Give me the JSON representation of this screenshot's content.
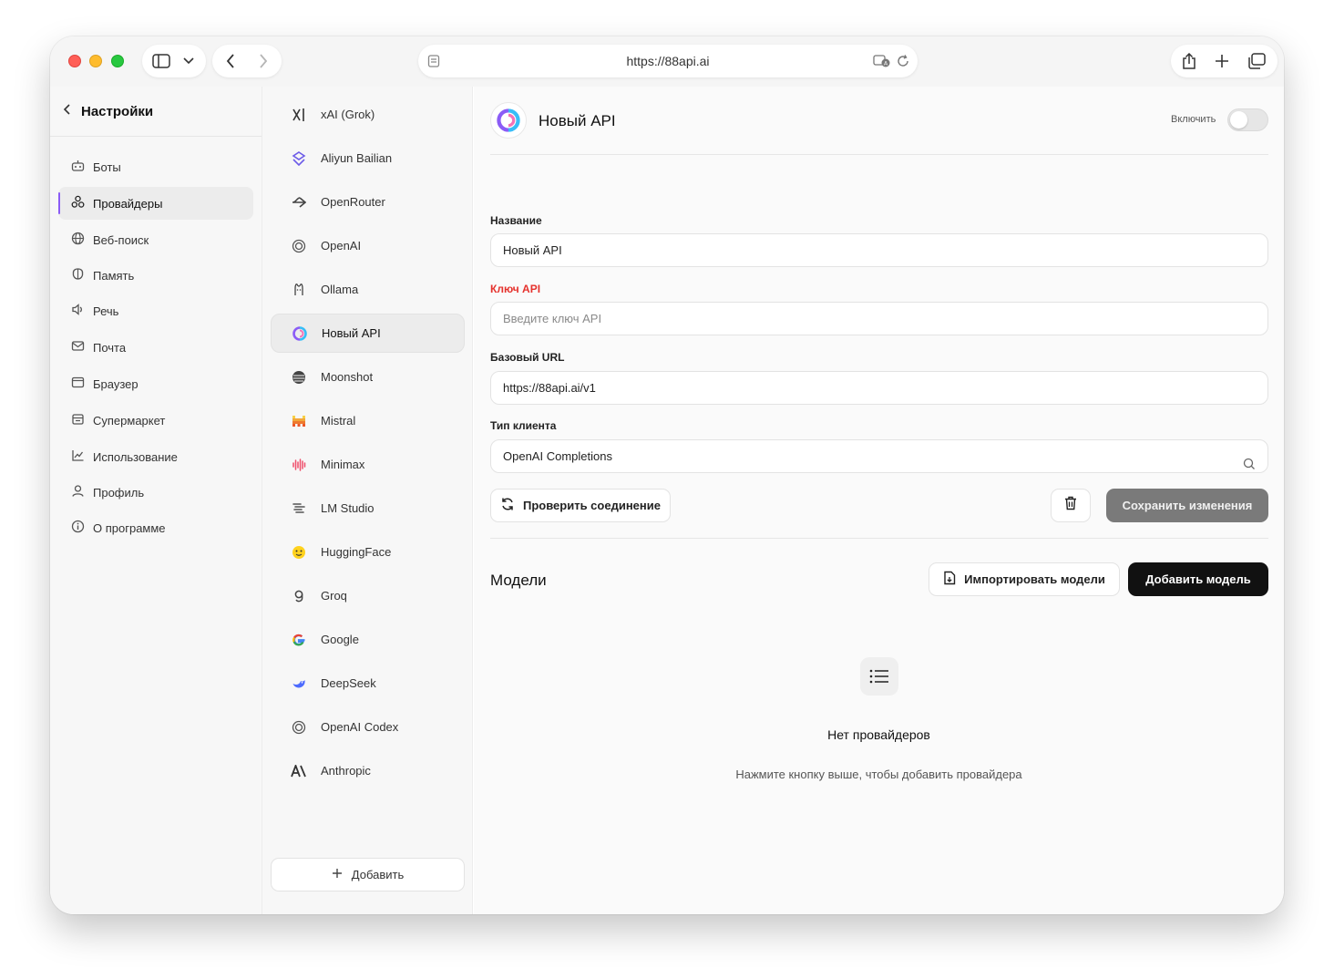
{
  "browser": {
    "url": "https://88api.ai"
  },
  "settings": {
    "title": "Настройки",
    "nav": [
      {
        "label": "Боты",
        "icon": "bot-icon"
      },
      {
        "label": "Провайдеры",
        "icon": "providers-icon",
        "active": true
      },
      {
        "label": "Веб-поиск",
        "icon": "globe-icon"
      },
      {
        "label": "Память",
        "icon": "memory-icon"
      },
      {
        "label": "Речь",
        "icon": "speaker-icon"
      },
      {
        "label": "Почта",
        "icon": "mail-icon"
      },
      {
        "label": "Браузер",
        "icon": "browser-icon"
      },
      {
        "label": "Супермаркет",
        "icon": "store-icon"
      },
      {
        "label": "Использование",
        "icon": "chart-icon"
      },
      {
        "label": "Профиль",
        "icon": "user-icon"
      },
      {
        "label": "О программе",
        "icon": "info-icon"
      }
    ]
  },
  "providers": {
    "items": [
      {
        "label": "xAI (Grok)",
        "icon": "xai-icon"
      },
      {
        "label": "Aliyun Bailian",
        "icon": "bailian-icon"
      },
      {
        "label": "OpenRouter",
        "icon": "openrouter-icon"
      },
      {
        "label": "OpenAI",
        "icon": "openai-icon"
      },
      {
        "label": "Ollama",
        "icon": "ollama-icon"
      },
      {
        "label": "Новый API",
        "icon": "newapi-icon",
        "active": true
      },
      {
        "label": "Moonshot",
        "icon": "moonshot-icon"
      },
      {
        "label": "Mistral",
        "icon": "mistral-icon"
      },
      {
        "label": "Minimax",
        "icon": "minimax-icon"
      },
      {
        "label": "LM Studio",
        "icon": "lmstudio-icon"
      },
      {
        "label": "HuggingFace",
        "icon": "huggingface-icon"
      },
      {
        "label": "Groq",
        "icon": "groq-icon"
      },
      {
        "label": "Google",
        "icon": "google-icon"
      },
      {
        "label": "DeepSeek",
        "icon": "deepseek-icon"
      },
      {
        "label": "OpenAI Codex",
        "icon": "openai-codex-icon"
      },
      {
        "label": "Anthropic",
        "icon": "anthropic-icon"
      }
    ],
    "add_label": "Добавить"
  },
  "detail": {
    "title": "Новый API",
    "enable_label": "Включить",
    "enabled": false,
    "name_label": "Название",
    "name_value": "Новый API",
    "key_label": "Ключ API",
    "key_placeholder": "Введите ключ API",
    "url_label": "Базовый URL",
    "url_value": "https://88api.ai/v1",
    "client_label": "Тип клиента",
    "client_value": "OpenAI Completions",
    "check_label": "Проверить соединение",
    "save_label": "Сохранить изменения"
  },
  "models": {
    "title": "Модели",
    "import_label": "Импортировать модели",
    "add_label": "Добавить модель",
    "empty_title": "Нет провайдеров",
    "empty_subtitle": "Нажмите кнопку выше, чтобы добавить провайдера"
  },
  "colors": {
    "accent": "#8b5cf6",
    "required": "#e5322d",
    "primary_button": "#111111",
    "disabled_button": "#7a7a7a"
  }
}
